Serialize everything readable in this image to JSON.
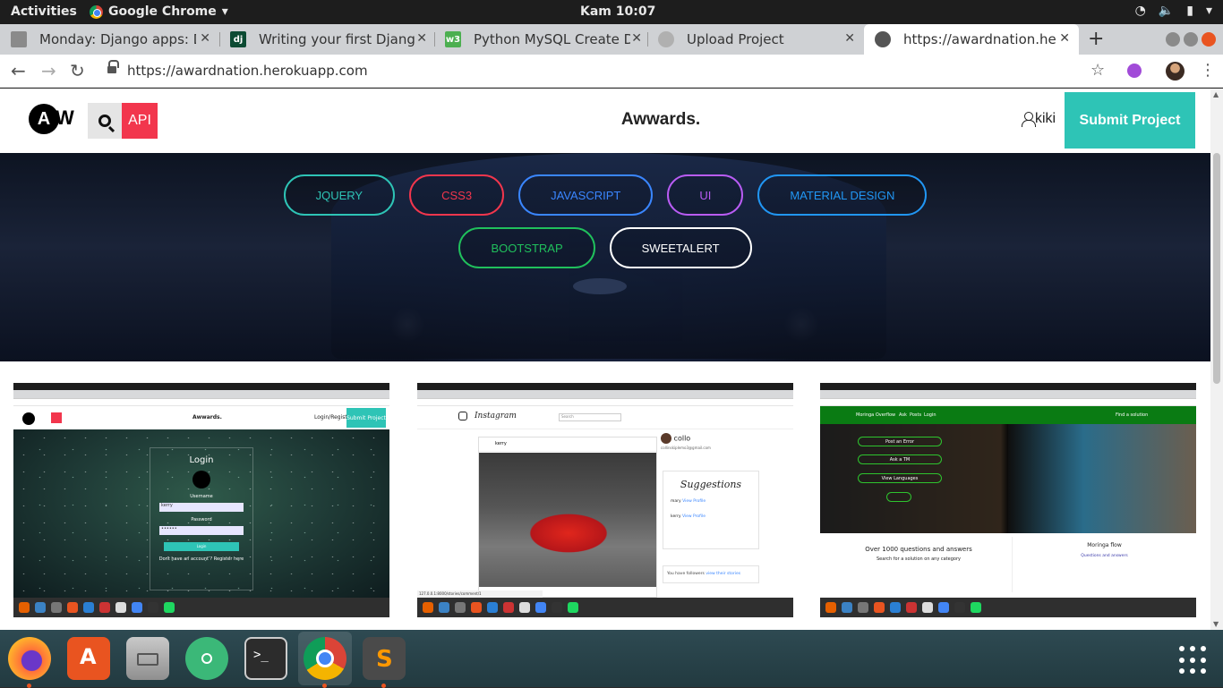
{
  "os": {
    "activities": "Activities",
    "app_menu": "Google Chrome",
    "clock": "Kam 10:07"
  },
  "tabs": [
    {
      "title": "Monday: Django apps: Dj",
      "favicon": "generic-page-icon",
      "color": "#8a8a8a"
    },
    {
      "title": "Writing your first Django",
      "favicon": "dj",
      "color": "#0c4b33"
    },
    {
      "title": "Python MySQL Create Dat",
      "favicon": "w3-icon",
      "color": "#4caf50"
    },
    {
      "title": "Upload Project",
      "favicon": "globe-icon",
      "color": "#b0b0b0"
    },
    {
      "title": "https://awardnation.hero",
      "favicon": "globe-icon",
      "color": "#555555"
    }
  ],
  "toolbar": {
    "url": "https://awardnation.herokuapp.com"
  },
  "site": {
    "api_label": "API",
    "brand": "Awwards.",
    "username": "kiki",
    "submit_label": "Submit Project",
    "logo": {
      "a": "A",
      "w": "W"
    }
  },
  "tags_row1": [
    {
      "label": "JQUERY",
      "color": "#2ec4b6"
    },
    {
      "label": "CSS3",
      "color": "#f2364d"
    },
    {
      "label": "JAVASCRIPT",
      "color": "#3a86ff"
    },
    {
      "label": "UI",
      "color": "#b95cf4"
    },
    {
      "label": "MATERIAL DESIGN",
      "color": "#2196f3"
    }
  ],
  "tags_row2": [
    {
      "label": "BOOTSTRAP",
      "color": "#20c05c"
    },
    {
      "label": "SWEETALERT",
      "color": "#ffffff"
    }
  ],
  "cards": {
    "c1": {
      "brand": "Awwards.",
      "login_register": "Login/Register",
      "submit": "Submit Project",
      "form_title": "Login",
      "username_label": "Username",
      "username_value": "kerry",
      "password_label": "Password",
      "password_value": "••••••",
      "button": "Login",
      "footer": "Dont have an account ? Register here"
    },
    "c2": {
      "app": "Instagram",
      "search_placeholder": "Search",
      "post_user": "kerry",
      "profile_name": "collo",
      "profile_email": "collinskiplemo3@gmail.com",
      "suggestions_title": "Suggestions",
      "suggestions": [
        {
          "name": "mary",
          "link": "View Profile"
        },
        {
          "name": "kerry",
          "link": "View Profile"
        }
      ],
      "followers_text": "You have followers",
      "followers_link": "view their stories",
      "status_url": "127.0.0.1:8000/stories/comment/1"
    },
    "c3": {
      "brand": "Moringa Overflow",
      "nav": [
        "Ask",
        "Posts",
        "Login"
      ],
      "find": "Find a solution",
      "buttons": [
        "Post an Error",
        "Ask a TM",
        "View Languages"
      ],
      "tagline": "Over 1000 questions and answers",
      "sub": "Search for a solution on any category",
      "right_title": "Moringa flow",
      "right_link": "Questions and answers"
    }
  }
}
